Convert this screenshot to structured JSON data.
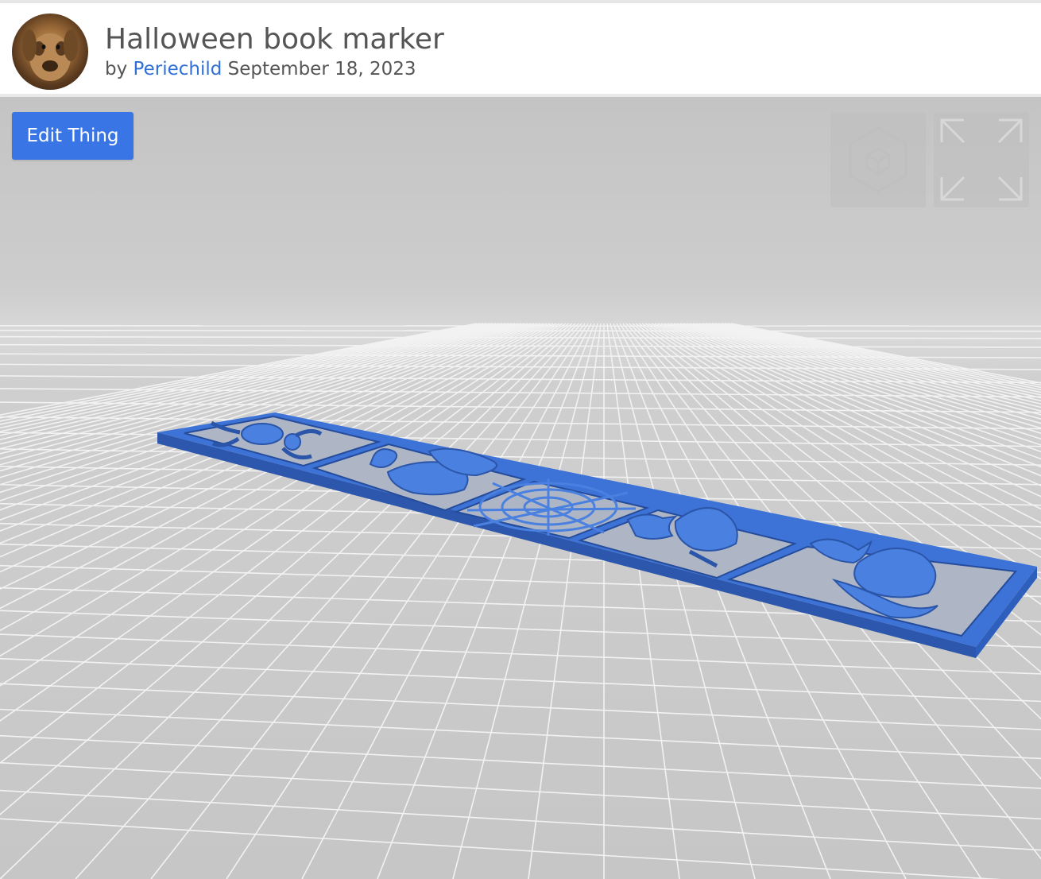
{
  "header": {
    "title": "Halloween book marker",
    "by_prefix": "by",
    "author": "Periechild",
    "date": "September 18, 2023",
    "avatar_alt": "user avatar"
  },
  "viewer": {
    "edit_button_label": "Edit Thing",
    "controls": [
      {
        "name": "3d-view-icon"
      },
      {
        "name": "fullscreen-icon"
      }
    ],
    "model": {
      "name": "bookmark-model",
      "color": "#3d72d6",
      "panels": [
        "spider",
        "ghost",
        "spider-web",
        "witch",
        "cat"
      ]
    },
    "grid_color": "#f2f2f2",
    "background_color": "#c8c8c8"
  }
}
